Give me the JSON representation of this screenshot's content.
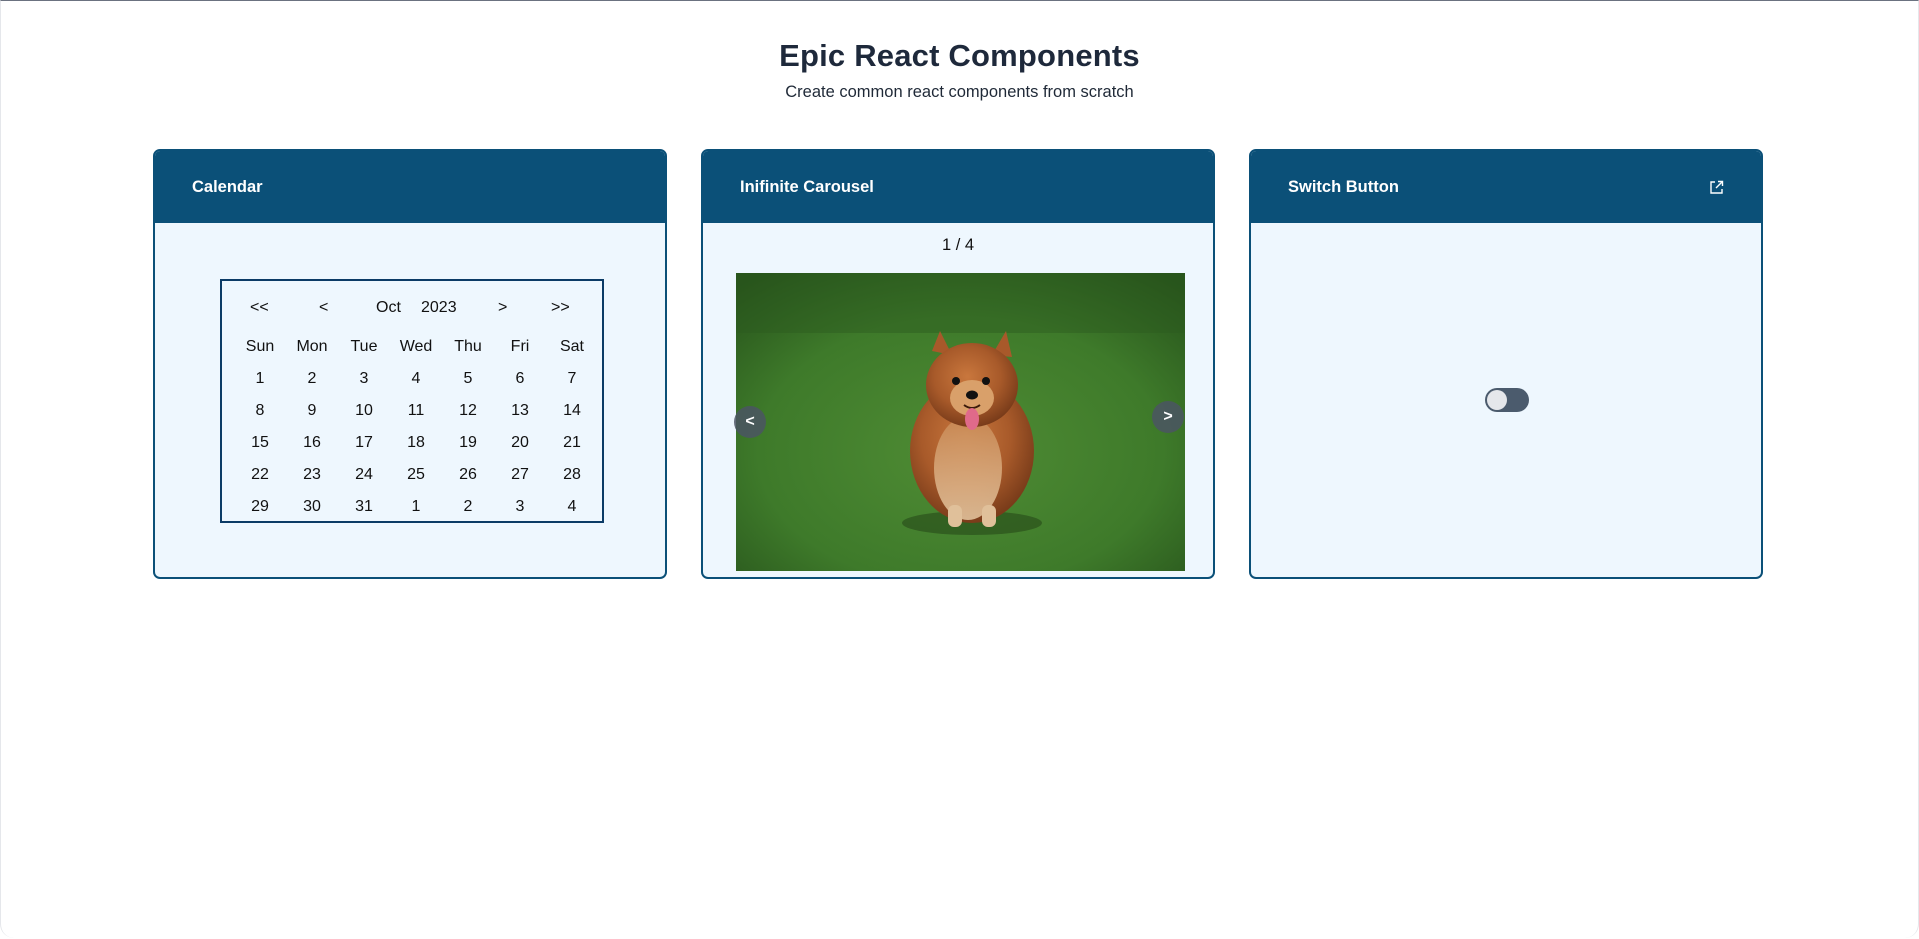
{
  "header": {
    "title": "Epic React Components",
    "subtitle": "Create common react components from scratch"
  },
  "cards": {
    "calendar": {
      "title": "Calendar",
      "nav": {
        "prev_year": "<<",
        "prev_month": "<",
        "month": "Oct",
        "year": "2023",
        "next_month": ">",
        "next_year": ">>"
      },
      "weekdays": [
        "Sun",
        "Mon",
        "Tue",
        "Wed",
        "Thu",
        "Fri",
        "Sat"
      ],
      "weeks": [
        [
          "1",
          "2",
          "3",
          "4",
          "5",
          "6",
          "7"
        ],
        [
          "8",
          "9",
          "10",
          "11",
          "12",
          "13",
          "14"
        ],
        [
          "15",
          "16",
          "17",
          "18",
          "19",
          "20",
          "21"
        ],
        [
          "22",
          "23",
          "24",
          "25",
          "26",
          "27",
          "28"
        ],
        [
          "29",
          "30",
          "31",
          "1",
          "2",
          "3",
          "4"
        ]
      ]
    },
    "carousel": {
      "title": "Inifinite Carousel",
      "counter": "1 / 4",
      "prev_label": "<",
      "next_label": ">",
      "image": "pomeranian-dog-on-grass"
    },
    "switch": {
      "title": "Switch Button",
      "open_icon": "external-link-icon",
      "checked": false
    }
  },
  "colors": {
    "card_header": "#0b5078",
    "card_body": "#eef7fe",
    "switch_track": "#4b5b6d"
  }
}
